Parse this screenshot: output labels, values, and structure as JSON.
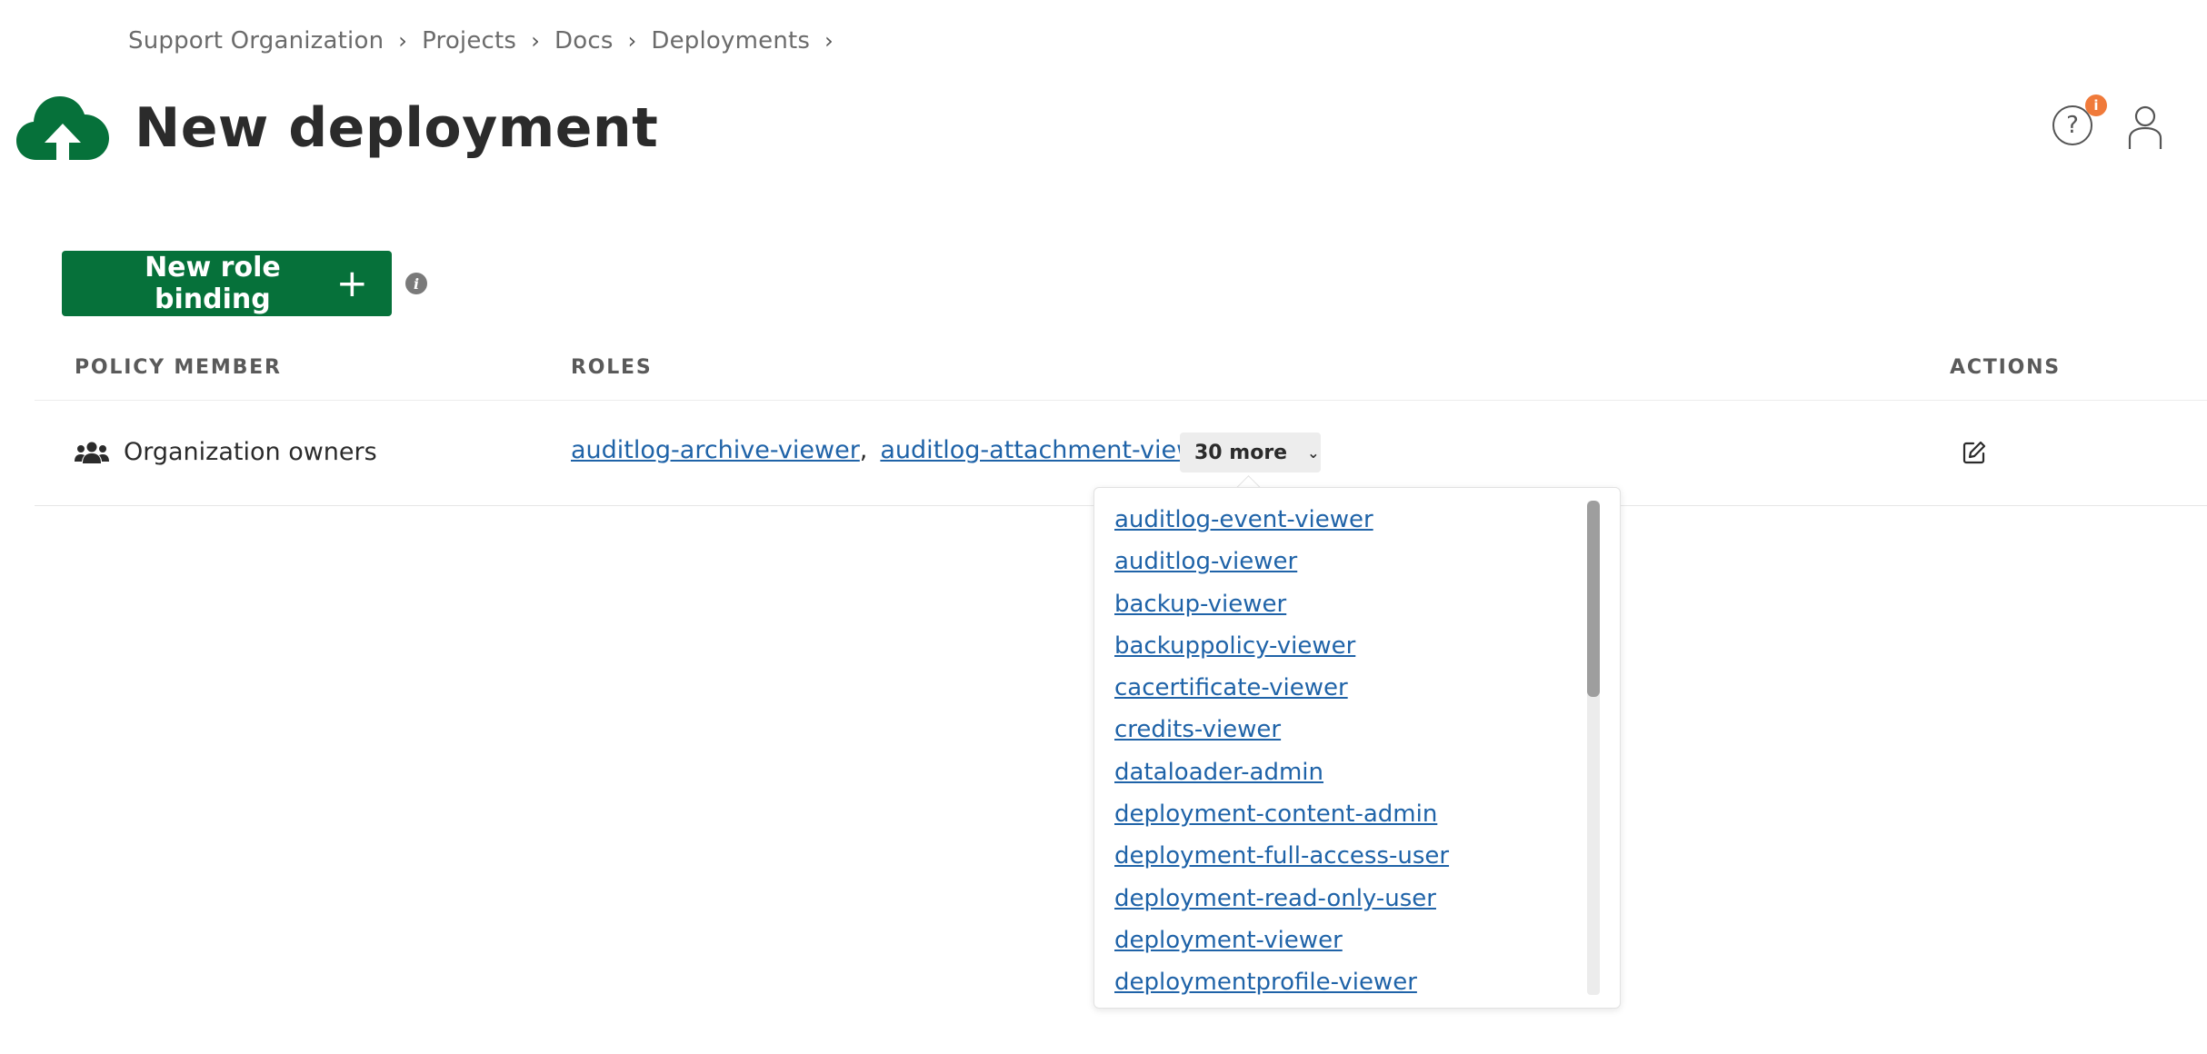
{
  "breadcrumb": {
    "items": [
      "Support Organization",
      "Projects",
      "Docs",
      "Deployments"
    ],
    "separator": "›"
  },
  "header": {
    "title": "New deployment",
    "icon": "cloud-upload-icon",
    "help_label": "?",
    "help_badge": "i"
  },
  "colors": {
    "brand_green": "#06713a",
    "link_blue": "#1f63a8",
    "badge_orange": "#f07a3a"
  },
  "actions": {
    "new_role_binding_label": "New role binding",
    "new_role_binding_icon": "+",
    "info_icon_label": "i"
  },
  "table": {
    "headers": {
      "member": "POLICY MEMBER",
      "roles": "ROLES",
      "actions": "ACTIONS"
    },
    "rows": [
      {
        "member": "Organization owners",
        "roles": [
          "auditlog-archive-viewer",
          "auditlog-attachment-viewer"
        ],
        "more_label": "30 more",
        "more_icon": "⌄"
      }
    ]
  },
  "more_dropdown": {
    "items": [
      "auditlog-event-viewer",
      "auditlog-viewer",
      "backup-viewer",
      "backuppolicy-viewer",
      "cacertificate-viewer",
      "credits-viewer",
      "dataloader-admin",
      "deployment-content-admin",
      "deployment-full-access-user",
      "deployment-read-only-user",
      "deployment-viewer",
      "deploymentprofile-viewer"
    ]
  }
}
